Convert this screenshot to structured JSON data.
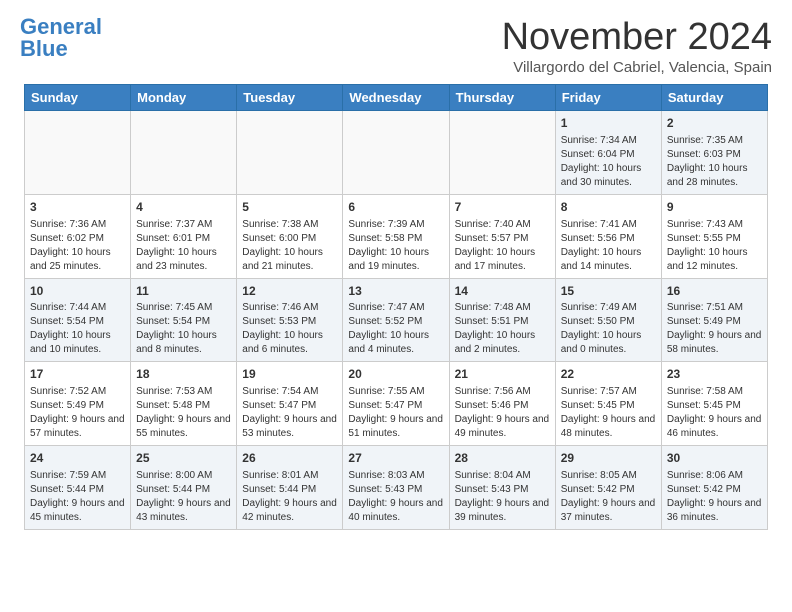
{
  "header": {
    "logo_general": "General",
    "logo_blue": "Blue",
    "month": "November 2024",
    "location": "Villargordo del Cabriel, Valencia, Spain"
  },
  "days_of_week": [
    "Sunday",
    "Monday",
    "Tuesday",
    "Wednesday",
    "Thursday",
    "Friday",
    "Saturday"
  ],
  "weeks": [
    [
      {
        "day": "",
        "info": ""
      },
      {
        "day": "",
        "info": ""
      },
      {
        "day": "",
        "info": ""
      },
      {
        "day": "",
        "info": ""
      },
      {
        "day": "",
        "info": ""
      },
      {
        "day": "1",
        "info": "Sunrise: 7:34 AM\nSunset: 6:04 PM\nDaylight: 10 hours and 30 minutes."
      },
      {
        "day": "2",
        "info": "Sunrise: 7:35 AM\nSunset: 6:03 PM\nDaylight: 10 hours and 28 minutes."
      }
    ],
    [
      {
        "day": "3",
        "info": "Sunrise: 7:36 AM\nSunset: 6:02 PM\nDaylight: 10 hours and 25 minutes."
      },
      {
        "day": "4",
        "info": "Sunrise: 7:37 AM\nSunset: 6:01 PM\nDaylight: 10 hours and 23 minutes."
      },
      {
        "day": "5",
        "info": "Sunrise: 7:38 AM\nSunset: 6:00 PM\nDaylight: 10 hours and 21 minutes."
      },
      {
        "day": "6",
        "info": "Sunrise: 7:39 AM\nSunset: 5:58 PM\nDaylight: 10 hours and 19 minutes."
      },
      {
        "day": "7",
        "info": "Sunrise: 7:40 AM\nSunset: 5:57 PM\nDaylight: 10 hours and 17 minutes."
      },
      {
        "day": "8",
        "info": "Sunrise: 7:41 AM\nSunset: 5:56 PM\nDaylight: 10 hours and 14 minutes."
      },
      {
        "day": "9",
        "info": "Sunrise: 7:43 AM\nSunset: 5:55 PM\nDaylight: 10 hours and 12 minutes."
      }
    ],
    [
      {
        "day": "10",
        "info": "Sunrise: 7:44 AM\nSunset: 5:54 PM\nDaylight: 10 hours and 10 minutes."
      },
      {
        "day": "11",
        "info": "Sunrise: 7:45 AM\nSunset: 5:54 PM\nDaylight: 10 hours and 8 minutes."
      },
      {
        "day": "12",
        "info": "Sunrise: 7:46 AM\nSunset: 5:53 PM\nDaylight: 10 hours and 6 minutes."
      },
      {
        "day": "13",
        "info": "Sunrise: 7:47 AM\nSunset: 5:52 PM\nDaylight: 10 hours and 4 minutes."
      },
      {
        "day": "14",
        "info": "Sunrise: 7:48 AM\nSunset: 5:51 PM\nDaylight: 10 hours and 2 minutes."
      },
      {
        "day": "15",
        "info": "Sunrise: 7:49 AM\nSunset: 5:50 PM\nDaylight: 10 hours and 0 minutes."
      },
      {
        "day": "16",
        "info": "Sunrise: 7:51 AM\nSunset: 5:49 PM\nDaylight: 9 hours and 58 minutes."
      }
    ],
    [
      {
        "day": "17",
        "info": "Sunrise: 7:52 AM\nSunset: 5:49 PM\nDaylight: 9 hours and 57 minutes."
      },
      {
        "day": "18",
        "info": "Sunrise: 7:53 AM\nSunset: 5:48 PM\nDaylight: 9 hours and 55 minutes."
      },
      {
        "day": "19",
        "info": "Sunrise: 7:54 AM\nSunset: 5:47 PM\nDaylight: 9 hours and 53 minutes."
      },
      {
        "day": "20",
        "info": "Sunrise: 7:55 AM\nSunset: 5:47 PM\nDaylight: 9 hours and 51 minutes."
      },
      {
        "day": "21",
        "info": "Sunrise: 7:56 AM\nSunset: 5:46 PM\nDaylight: 9 hours and 49 minutes."
      },
      {
        "day": "22",
        "info": "Sunrise: 7:57 AM\nSunset: 5:45 PM\nDaylight: 9 hours and 48 minutes."
      },
      {
        "day": "23",
        "info": "Sunrise: 7:58 AM\nSunset: 5:45 PM\nDaylight: 9 hours and 46 minutes."
      }
    ],
    [
      {
        "day": "24",
        "info": "Sunrise: 7:59 AM\nSunset: 5:44 PM\nDaylight: 9 hours and 45 minutes."
      },
      {
        "day": "25",
        "info": "Sunrise: 8:00 AM\nSunset: 5:44 PM\nDaylight: 9 hours and 43 minutes."
      },
      {
        "day": "26",
        "info": "Sunrise: 8:01 AM\nSunset: 5:44 PM\nDaylight: 9 hours and 42 minutes."
      },
      {
        "day": "27",
        "info": "Sunrise: 8:03 AM\nSunset: 5:43 PM\nDaylight: 9 hours and 40 minutes."
      },
      {
        "day": "28",
        "info": "Sunrise: 8:04 AM\nSunset: 5:43 PM\nDaylight: 9 hours and 39 minutes."
      },
      {
        "day": "29",
        "info": "Sunrise: 8:05 AM\nSunset: 5:42 PM\nDaylight: 9 hours and 37 minutes."
      },
      {
        "day": "30",
        "info": "Sunrise: 8:06 AM\nSunset: 5:42 PM\nDaylight: 9 hours and 36 minutes."
      }
    ]
  ]
}
